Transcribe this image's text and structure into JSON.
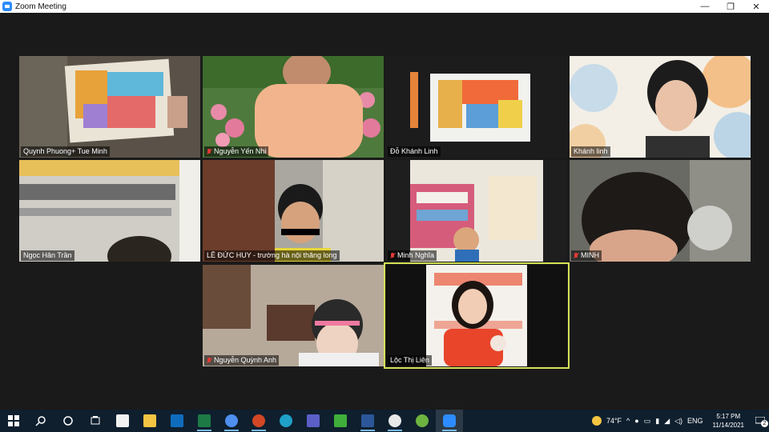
{
  "window": {
    "title": "Zoom Meeting",
    "minimize": "—",
    "maximize": "❐",
    "close": "✕"
  },
  "participants": [
    {
      "name": "Quynh Phuong+ Tue Minh",
      "muted": false
    },
    {
      "name": "Nguyễn Yến Nhi",
      "muted": true
    },
    {
      "name": "Đỗ Khánh Linh",
      "muted": false
    },
    {
      "name": "Khánh linh",
      "muted": false
    },
    {
      "name": "Ngọc Hân Trần",
      "muted": false
    },
    {
      "name": "LÊ ĐỨC HUY - trường hà nội thăng long",
      "muted": false
    },
    {
      "name": "Minh Nghĩa",
      "muted": true
    },
    {
      "name": "MINH",
      "muted": true
    },
    {
      "name": "Nguyễn Quỳnh Anh",
      "muted": true
    },
    {
      "name": "Lộc Thị Liên",
      "muted": false,
      "active_speaker": true
    }
  ],
  "taskbar": {
    "weather_temp": "74°F",
    "language": "ENG",
    "time": "5:17 PM",
    "date": "11/14/2021",
    "notification_count": "2",
    "apps": [
      "start-icon",
      "search-icon",
      "cortana-icon",
      "task-view-icon",
      "store-icon",
      "file-explorer-icon",
      "mail-icon",
      "excel-icon",
      "chrome-icon",
      "powerpoint-icon",
      "edge-icon",
      "teams-icon",
      "camtasia-icon",
      "word-icon",
      "chrome-badge-icon",
      "greenshot-icon",
      "zoom-icon"
    ]
  },
  "colors": {
    "active_speaker_border": "#d4e157",
    "mute_red": "#e53935",
    "zoom_blue": "#2d8cff",
    "taskbar_bg": "#0f1f2e"
  }
}
